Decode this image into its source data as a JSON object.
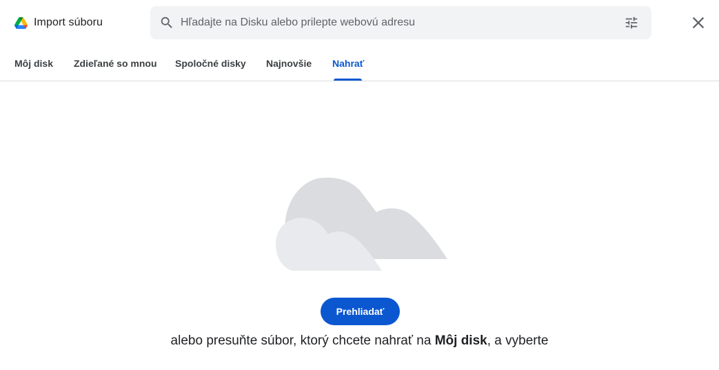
{
  "header": {
    "title": "Import súboru",
    "logo_icon": "google-drive-logo",
    "search": {
      "placeholder": "Hľadajte na Disku alebo prilepte webovú adresu",
      "value": "",
      "search_icon": "search-icon",
      "filter_icon": "tune-icon"
    },
    "close_icon": "close-icon"
  },
  "tabs": [
    {
      "label": "Môj disk",
      "active": false
    },
    {
      "label": "Zdieľané so mnou",
      "active": false
    },
    {
      "label": "Spoločné disky",
      "active": false
    },
    {
      "label": "Najnovšie",
      "active": false
    },
    {
      "label": "Nahrať",
      "active": true
    }
  ],
  "upload": {
    "illustration_icon": "cloud-illustration",
    "browse_label": "Prehliadať",
    "drop_text_before": "alebo presuňte súbor, ktorý chcete nahrať na ",
    "drop_text_bold": "Môj disk",
    "drop_text_after": ", a vyberte"
  },
  "colors": {
    "accent": "#0b57d0",
    "search_bg": "#f1f3f4",
    "divider": "#dadce0",
    "cloud_dark": "#dadce0",
    "cloud_light": "#e8eaed"
  }
}
